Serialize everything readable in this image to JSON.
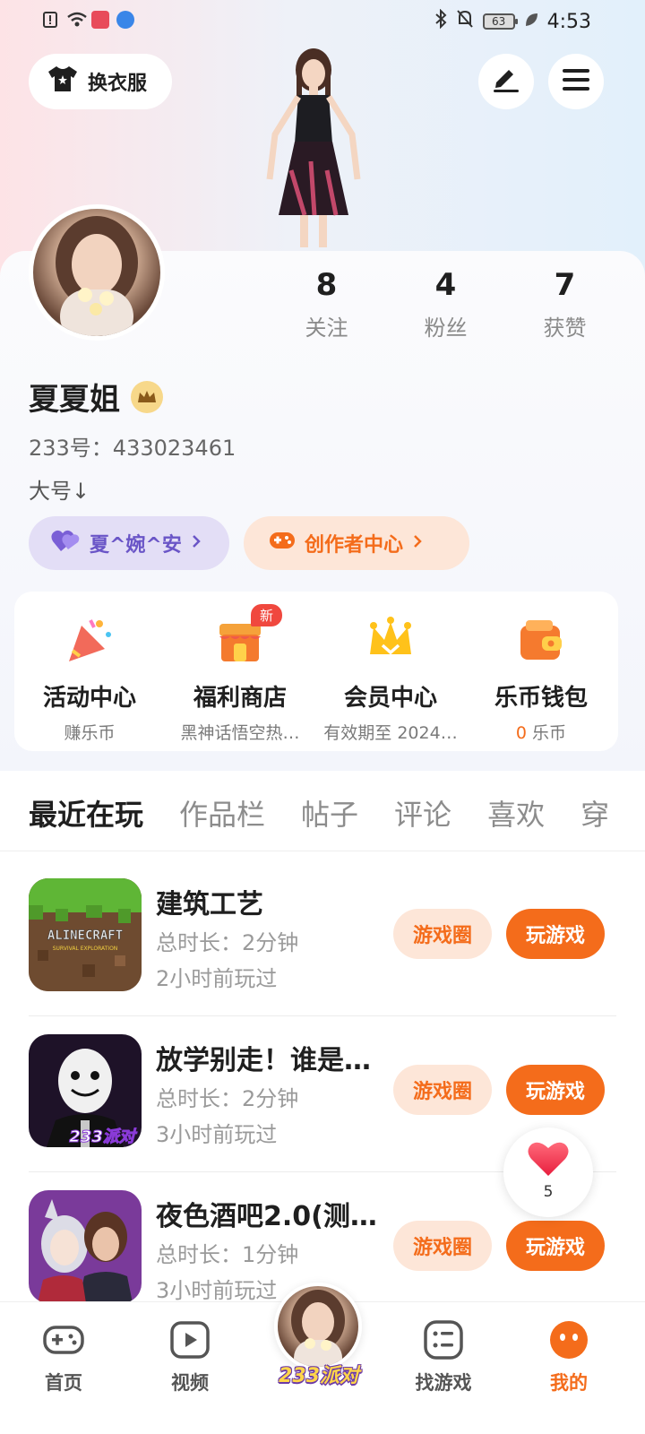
{
  "status_bar": {
    "time": "4:53",
    "battery": "63"
  },
  "header": {
    "outfit_label": "换衣服"
  },
  "profile": {
    "name": "夏夏姐",
    "id_text": "233号：433023461",
    "bio": "大号↓",
    "stats": [
      {
        "value": "8",
        "label": "关注"
      },
      {
        "value": "4",
        "label": "粉丝"
      },
      {
        "value": "7",
        "label": "获赞"
      }
    ],
    "linked_account": "夏^婉^安",
    "creator_center": "创作者中心"
  },
  "features": [
    {
      "title": "活动中心",
      "sub": "赚乐币"
    },
    {
      "title": "福利商店",
      "sub": "黑神话悟空热…",
      "badge": "新"
    },
    {
      "title": "会员中心",
      "sub": "有效期至 2024…"
    },
    {
      "title": "乐币钱包",
      "sub_value": "0",
      "sub_unit": " 乐币"
    }
  ],
  "tabs": [
    "最近在玩",
    "作品栏",
    "帖子",
    "评论",
    "喜欢",
    "穿"
  ],
  "games": [
    {
      "name": "建筑工艺",
      "duration": "总时长：2分钟",
      "last_played": "2小时前玩过",
      "circle_btn": "游戏圈",
      "play_btn": "玩游戏",
      "icon_text": "ALINECRAFT",
      "icon_sub": "SURVIVAL EXPLORATION"
    },
    {
      "name": "放学别走！谁是…",
      "duration": "总时长：2分钟",
      "last_played": "3小时前玩过",
      "circle_btn": "游戏圈",
      "play_btn": "玩游戏",
      "icon_text": "233派对"
    },
    {
      "name": "夜色酒吧2.0(测…",
      "duration": "总时长：1分钟",
      "last_played": "3小时前玩过",
      "circle_btn": "游戏圈",
      "play_btn": "玩游戏"
    }
  ],
  "floating_like": {
    "count": "5"
  },
  "bottom_nav": [
    {
      "label": "首页"
    },
    {
      "label": "视频"
    },
    {
      "label": "233派对"
    },
    {
      "label": "找游戏"
    },
    {
      "label": "我的"
    }
  ],
  "colors": {
    "accent": "#f46c1b",
    "purple": "#6a55c7"
  }
}
